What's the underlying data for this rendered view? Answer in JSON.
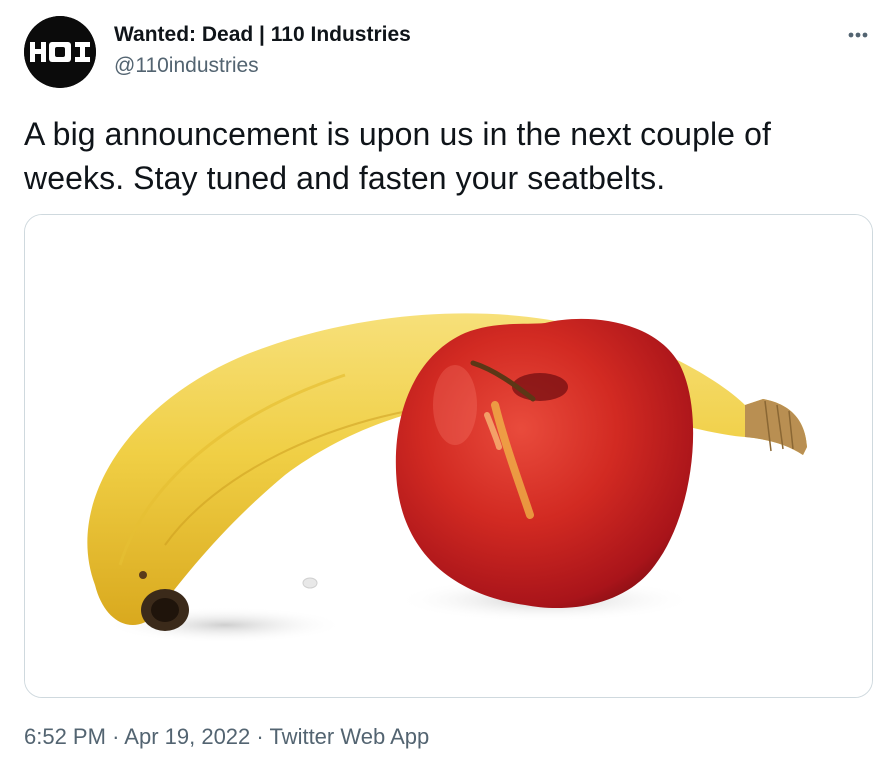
{
  "tweet": {
    "author": {
      "display_name": "Wanted: Dead | 110 Industries",
      "handle": "@110industries",
      "avatar_text": "HOI"
    },
    "text": "A big announcement is upon us in the next couple of weeks. Stay tuned and fasten your seatbelts.",
    "media": {
      "subjects": [
        "banana",
        "apple"
      ]
    },
    "meta": {
      "time": "6:52 PM",
      "separator": "·",
      "date": "Apr 19, 2022",
      "source": "Twitter Web App"
    },
    "more_icon": "ellipsis-icon"
  },
  "colors": {
    "text_primary": "#0f1419",
    "text_secondary": "#536471",
    "border": "#cfd9de",
    "avatar_bg": "#0b0b0b"
  }
}
